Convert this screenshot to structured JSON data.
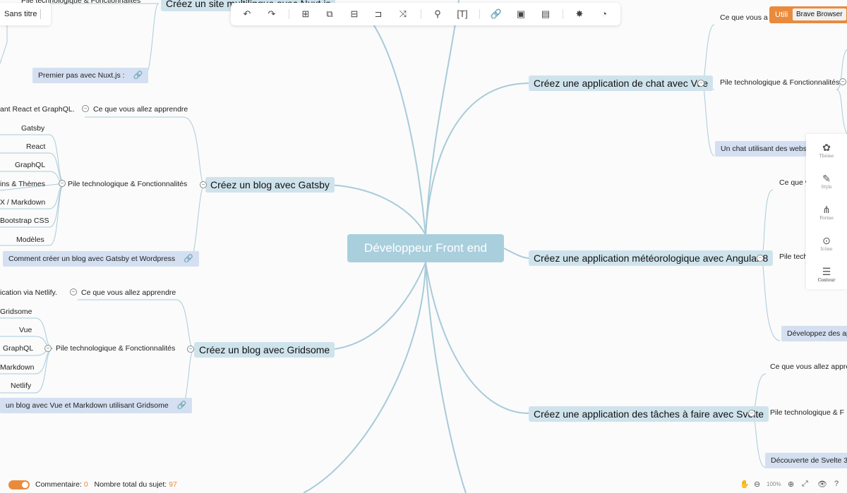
{
  "app": {
    "file_name": "Sans titre",
    "browser_badge": "Utili",
    "browser_tooltip": "Brave Browser"
  },
  "toolbar": {
    "icons": [
      "undo-icon",
      "redo-icon",
      "subtopic-icon",
      "sibling-topic-icon",
      "floating-topic-icon",
      "relationship-icon",
      "boundary-icon",
      "summary-icon",
      "format-painter-icon",
      "text-style-icon",
      "link-icon",
      "image-icon",
      "note-icon",
      "magic-icon",
      "pitch-icon"
    ]
  },
  "mindmap": {
    "root": "Développeur Front end",
    "branches": {
      "nuxt": {
        "title": "Créez un site multilingue avec Nuxt.js",
        "sub_stack": "Pile technologique & Fonctionnalités",
        "note": "Premier pas avec Nuxt.js :"
      },
      "gatsby": {
        "title": "Créez un blog avec Gatsby",
        "learn_prefix": "ant React et GraphQL.",
        "learn": "Ce que vous allez apprendre",
        "stack": "Pile technologique & Fonctionnalités",
        "items": [
          "Gatsby",
          "React",
          "GraphQL",
          "ins & Thèmes",
          "X / Markdown",
          "Bootstrap CSS",
          "Modèles"
        ],
        "note": "Comment créer un blog avec Gatsby et Wordpress"
      },
      "gridsome": {
        "title": "Créez un blog avec Gridsome",
        "learn_prefix": "ication via Netlify.",
        "learn": "Ce que vous allez apprendre",
        "stack": "Pile technologique & Fonctionnalités",
        "items": [
          "Gridsome",
          "Vue",
          "GraphQL",
          "Markdown",
          "Netlify"
        ],
        "note": "un blog avec Vue et Markdown utilisant Gridsome"
      },
      "vue_chat": {
        "title": "Créez une application de chat avec Vue",
        "learn": "Ce que vous a",
        "stack": "Pile technologique & Fonctionnalités",
        "note": "Un chat utilisant des websoc"
      },
      "angular": {
        "title": "Créez une application météorologique avec Angular 8",
        "learn": "Ce que v",
        "stack": "Pile tech",
        "note": "Développez des ap"
      },
      "svelte": {
        "title": "Créez une application des tâches à faire avec Svelte",
        "learn": "Ce que vous allez appre",
        "stack": "Pile technologique & F",
        "note": "Découverte de Svelte 3"
      }
    }
  },
  "right_panel": [
    {
      "label": "Thème",
      "icon": "theme-icon"
    },
    {
      "label": "Style",
      "icon": "style-icon"
    },
    {
      "label": "Forme",
      "icon": "structure-icon"
    },
    {
      "label": "Icône",
      "icon": "sticker-icon"
    },
    {
      "label": "Contour",
      "icon": "outline-icon"
    }
  ],
  "status": {
    "comment_label": "Commentaire:",
    "comment_count": "0",
    "total_label": "Nombre total du sujet:",
    "total_count": "97"
  },
  "zoom": {
    "level": "100%"
  }
}
